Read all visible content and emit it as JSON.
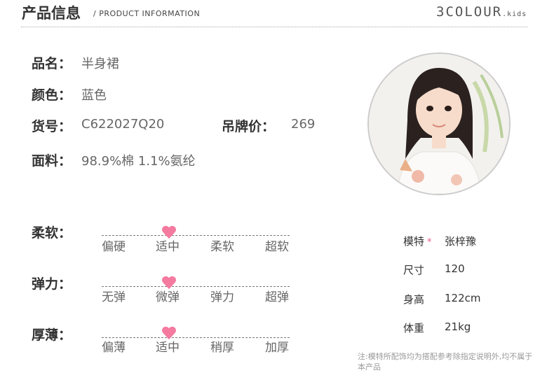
{
  "header": {
    "title": "产品信息",
    "subtitle": "/ PRODUCT INFORMATION",
    "brand_main": "3COLOUR",
    "brand_small": ".kids"
  },
  "product": {
    "name_label": "品名：",
    "name_value": "半身裙",
    "color_label": "颜色：",
    "color_value": "蓝色",
    "sku_label": "货号：",
    "sku_value": "C622027Q20",
    "price_label": "吊牌价：",
    "price_value": "269",
    "fabric_label": "面料：",
    "fabric_value": "98.9%棉 1.1%氨纶"
  },
  "scales": [
    {
      "label": "柔软：",
      "options": [
        "偏硬",
        "适中",
        "柔软",
        "超软"
      ],
      "selected_index": 1
    },
    {
      "label": "弹力：",
      "options": [
        "无弹",
        "微弹",
        "弹力",
        "超弹"
      ],
      "selected_index": 1
    },
    {
      "label": "厚薄：",
      "options": [
        "偏薄",
        "适中",
        "稍厚",
        "加厚"
      ],
      "selected_index": 1
    }
  ],
  "model": {
    "rows": [
      {
        "label": "模特",
        "star": "*",
        "value": "张梓豫"
      },
      {
        "label": "尺寸",
        "value": "120"
      },
      {
        "label": "身高",
        "value": "122cm"
      },
      {
        "label": "体重",
        "value": "21kg"
      }
    ],
    "note": "注:模特所配饰均为搭配参考除指定说明外,均不属于本产品"
  },
  "colors": {
    "heart": "#f47aa0",
    "star": "#e75a8a",
    "text_dark": "#333333",
    "text_mid": "#666666"
  }
}
